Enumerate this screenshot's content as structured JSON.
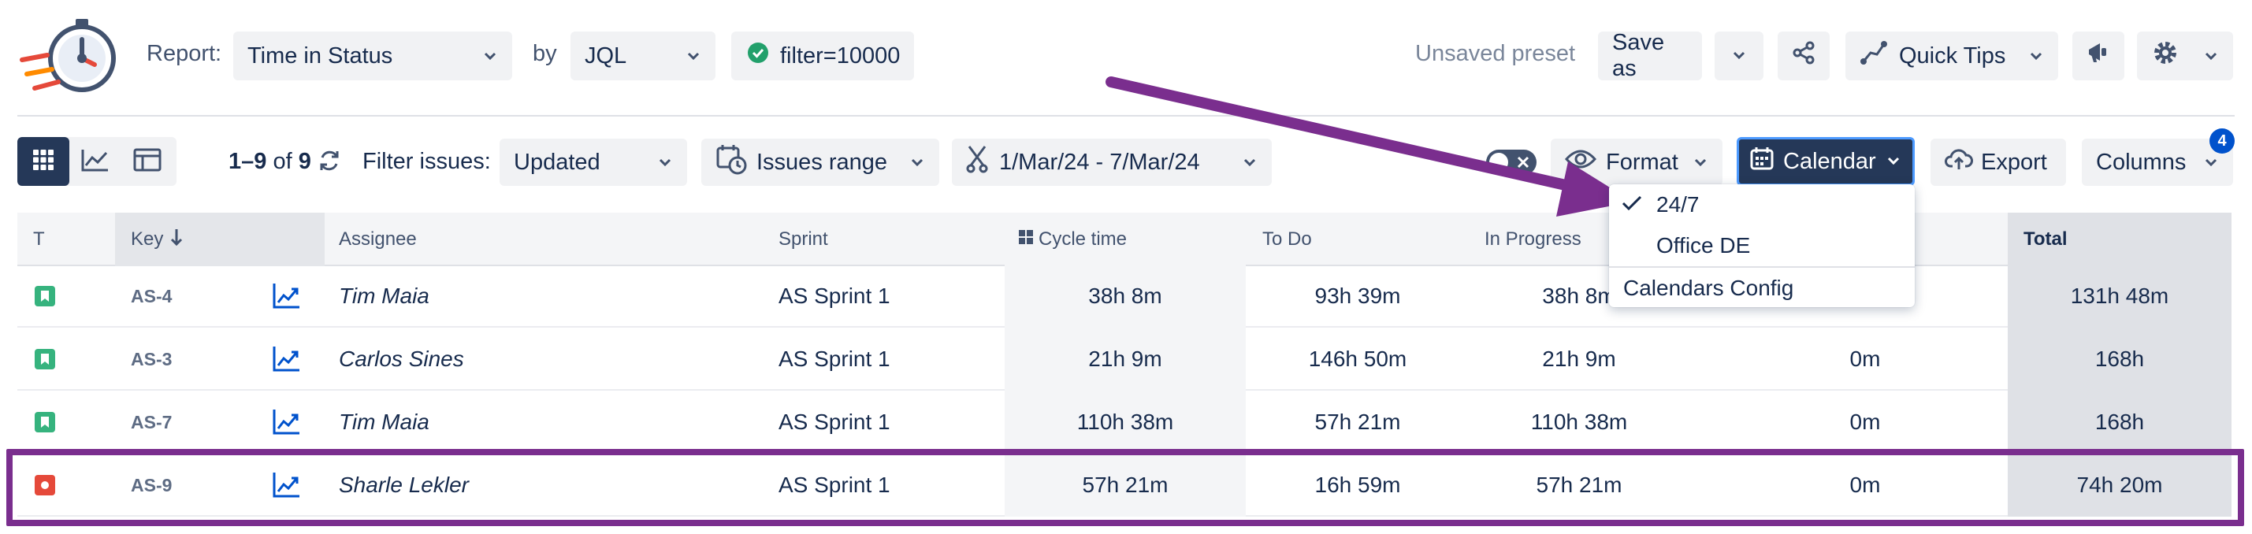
{
  "toolbar": {
    "report_label": "Report:",
    "report_value": "Time in Status",
    "by_label": "by",
    "by_value": "JQL",
    "filter_value": "filter=10000",
    "unsaved_preset": "Unsaved preset",
    "save_as": "Save as",
    "quick_tips": "Quick Tips"
  },
  "subbar": {
    "range_prefix": "1–9",
    "of_label": "of",
    "total_count": "9",
    "filter_issues_label": "Filter issues:",
    "filter_issues_value": "Updated",
    "issues_range": "Issues range",
    "date_range": "1/Mar/24 - 7/Mar/24",
    "format": "Format",
    "calendar": "Calendar",
    "export": "Export",
    "columns": "Columns",
    "columns_badge": "4"
  },
  "calendar_menu": {
    "items": [
      "24/7",
      "Office DE"
    ],
    "selected": "24/7",
    "config": "Calendars Config"
  },
  "table": {
    "headers": {
      "type": "T",
      "key": "Key",
      "assignee": "Assignee",
      "sprint": "Sprint",
      "cycle_time": "Cycle time",
      "todo": "To Do",
      "in_progress": "In Progress",
      "total": "Total"
    },
    "rows": [
      {
        "key": "AS-4",
        "assignee": "Tim Maia",
        "sprint": "AS Sprint 1",
        "cycle": "38h 8m",
        "todo": "93h 39m",
        "inprog": "38h 8m",
        "extra": "",
        "total": "131h 48m",
        "type": "story"
      },
      {
        "key": "AS-3",
        "assignee": "Carlos Sines",
        "sprint": "AS Sprint 1",
        "cycle": "21h 9m",
        "todo": "146h 50m",
        "inprog": "21h 9m",
        "extra": "0m",
        "total": "168h",
        "type": "story"
      },
      {
        "key": "AS-7",
        "assignee": "Tim Maia",
        "sprint": "AS Sprint 1",
        "cycle": "110h 38m",
        "todo": "57h 21m",
        "inprog": "110h 38m",
        "extra": "0m",
        "total": "168h",
        "type": "story"
      },
      {
        "key": "AS-9",
        "assignee": "Sharle Lekler",
        "sprint": "AS Sprint 1",
        "cycle": "57h 21m",
        "todo": "16h 59m",
        "inprog": "57h 21m",
        "extra": "0m",
        "total": "74h 20m",
        "type": "bug"
      }
    ]
  },
  "colors": {
    "accent_dark": "#253858",
    "story": "#36b37e",
    "bug": "#e5493a",
    "highlight": "#7a2e8e",
    "link_blue": "#0052cc"
  }
}
